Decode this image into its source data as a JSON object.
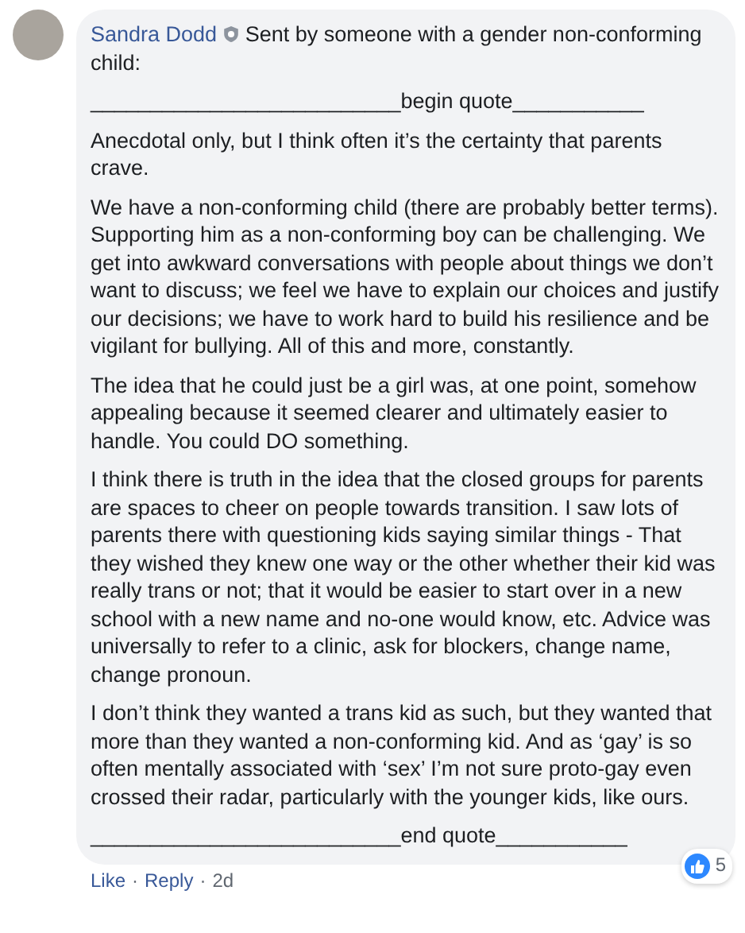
{
  "comment": {
    "author": "Sandra Dodd",
    "intro": "Sent by someone with a gender non-conforming child:",
    "paragraphs": [
      "__________________________begin quote___________",
      "Anecdotal only, but I think often it’s the certainty that parents crave.",
      "We have a non-conforming child (there are probably better terms). Supporting him as a non-conforming boy can be challenging. We get into awkward conversations with people about things we don’t want to discuss; we feel we have to explain our choices and justify our decisions; we have to work hard to build his resilience and be vigilant for bullying. All of this and more, constantly.",
      "The idea that he could just be a girl was, at one point, somehow appealing because it seemed clearer and ultimately easier to handle. You could DO something.",
      "I think there is truth in the idea that the closed groups for parents are spaces to cheer on people towards transition. I saw lots of parents there with questioning kids saying similar things - That they wished they knew one way or the other whether their kid was really trans or not; that it would be easier to start over in a new school with a new name and no-one would know, etc. Advice was universally to refer to a clinic, ask for blockers, change name, change pronoun.",
      "I don’t think they wanted a trans kid as such, but they wanted that more than they wanted a non-conforming kid. And as ‘gay’ is so often mentally associated with ‘sex’ I’m not sure proto-gay even crossed their radar, particularly with the younger kids, like ours.",
      "__________________________end quote___________"
    ],
    "actions": [
      "Like",
      "Reply",
      "2d"
    ],
    "action_separator": "·",
    "reaction_count": "5"
  }
}
